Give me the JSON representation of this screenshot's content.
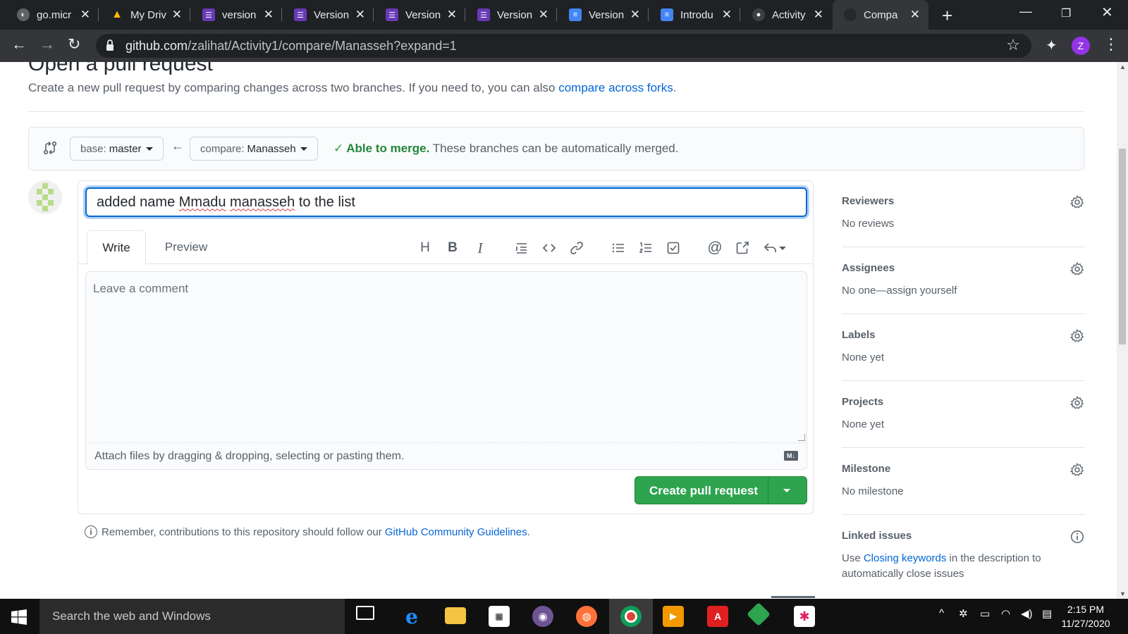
{
  "browser": {
    "tabs": [
      {
        "title": "go.micr",
        "icon": "globe-icon",
        "color": "#5f6368"
      },
      {
        "title": "My Driv",
        "icon": "google-drive-icon",
        "color": "#1fa463"
      },
      {
        "title": "version",
        "icon": "forms-icon",
        "color": "#673ab7"
      },
      {
        "title": "Version",
        "icon": "forms-icon",
        "color": "#673ab7"
      },
      {
        "title": "Version",
        "icon": "forms-icon",
        "color": "#673ab7"
      },
      {
        "title": "Version",
        "icon": "forms-icon",
        "color": "#673ab7"
      },
      {
        "title": "Version",
        "icon": "docs-icon",
        "color": "#4285f4"
      },
      {
        "title": "Introdu",
        "icon": "docs-icon",
        "color": "#4285f4"
      },
      {
        "title": "Activity",
        "icon": "github-icon",
        "color": "#24292e"
      },
      {
        "title": "Compa",
        "icon": "github-icon",
        "color": "#24292e"
      }
    ],
    "url_host": "github.com",
    "url_path": "/zalihat/Activity1/compare/Manasseh?expand=1",
    "profile_initial": "Z"
  },
  "page": {
    "title": "Open a pull request",
    "subtitle": "Create a new pull request by comparing changes across two branches. If you need to, you can also ",
    "subtitle_link": "compare across forks",
    "subtitle_end": ".",
    "base_label": "base:",
    "base_branch": "master",
    "compare_label": "compare:",
    "compare_branch": "Manasseh",
    "merge_ok": "Able to merge.",
    "merge_text": " These branches can be automatically merged.",
    "pr_title_parts": [
      "added name ",
      "Mmadu",
      " ",
      "manasseh",
      " to the list"
    ],
    "tab_write": "Write",
    "tab_preview": "Preview",
    "comment_placeholder": "Leave a comment",
    "attach_text": "Attach files by dragging & dropping, selecting or pasting them.",
    "markdown_badge": "M↓",
    "create_button": "Create pull request",
    "guidelines_prefix": "Remember, contributions to this repository should follow our ",
    "guidelines_link": "GitHub Community Guidelines",
    "guidelines_suffix": "."
  },
  "sidebar": [
    {
      "heading": "Reviewers",
      "value": "No reviews",
      "icon": "gear-icon"
    },
    {
      "heading": "Assignees",
      "value": "No one—assign yourself",
      "icon": "gear-icon"
    },
    {
      "heading": "Labels",
      "value": "None yet",
      "icon": "gear-icon"
    },
    {
      "heading": "Projects",
      "value": "None yet",
      "icon": "gear-icon"
    },
    {
      "heading": "Milestone",
      "value": "No milestone",
      "icon": "gear-icon"
    },
    {
      "heading": "Linked issues",
      "value_prefix": "Use ",
      "value_link": "Closing keywords",
      "value_suffix": " in the description to",
      "value_line2": "automatically close issues",
      "icon": "info-icon"
    }
  ],
  "taskbar": {
    "search_placeholder": "Search the web and Windows",
    "time": "2:15 PM",
    "date": "11/27/2020"
  }
}
